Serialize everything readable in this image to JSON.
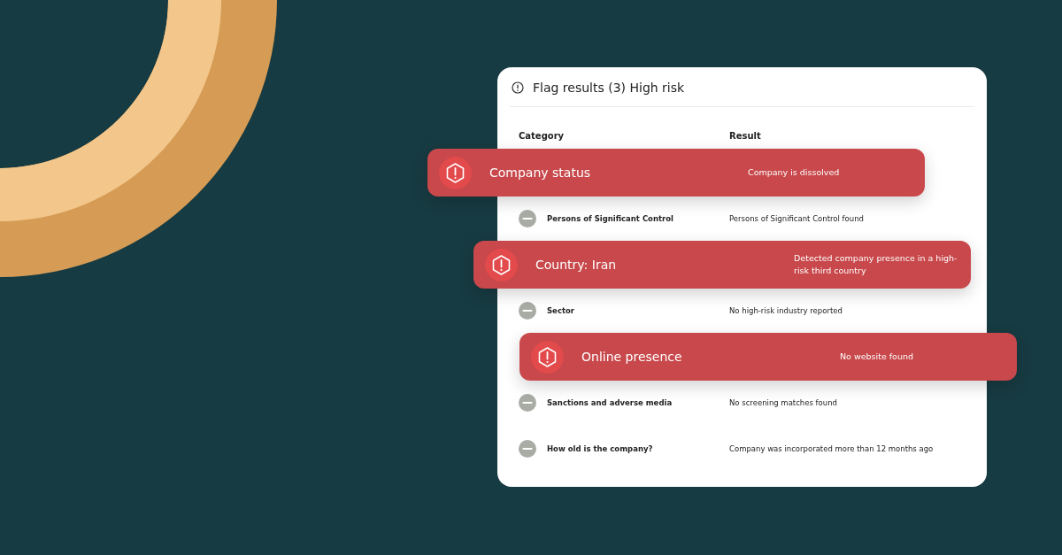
{
  "card": {
    "title": "Flag results (3) High risk",
    "columns": [
      "Category",
      "Result"
    ],
    "rows": [
      {
        "kind": "flag",
        "category": "Company status",
        "result": "Company is dissolved"
      },
      {
        "kind": "neutral",
        "category": "Persons of Significant Control",
        "result": "Persons of Significant Control found"
      },
      {
        "kind": "flag",
        "category": "Country: Iran",
        "result": "Detected company presence in a high-risk third country"
      },
      {
        "kind": "neutral",
        "category": "Sector",
        "result": "No high-risk industry reported"
      },
      {
        "kind": "flag",
        "category": "Online presence",
        "result": "No website found"
      },
      {
        "kind": "neutral",
        "category": "Sanctions and adverse media",
        "result": "No screening matches found"
      },
      {
        "kind": "neutral",
        "category": "How old is the company?",
        "result": "Company was incorporated more than 12 months ago"
      }
    ]
  }
}
